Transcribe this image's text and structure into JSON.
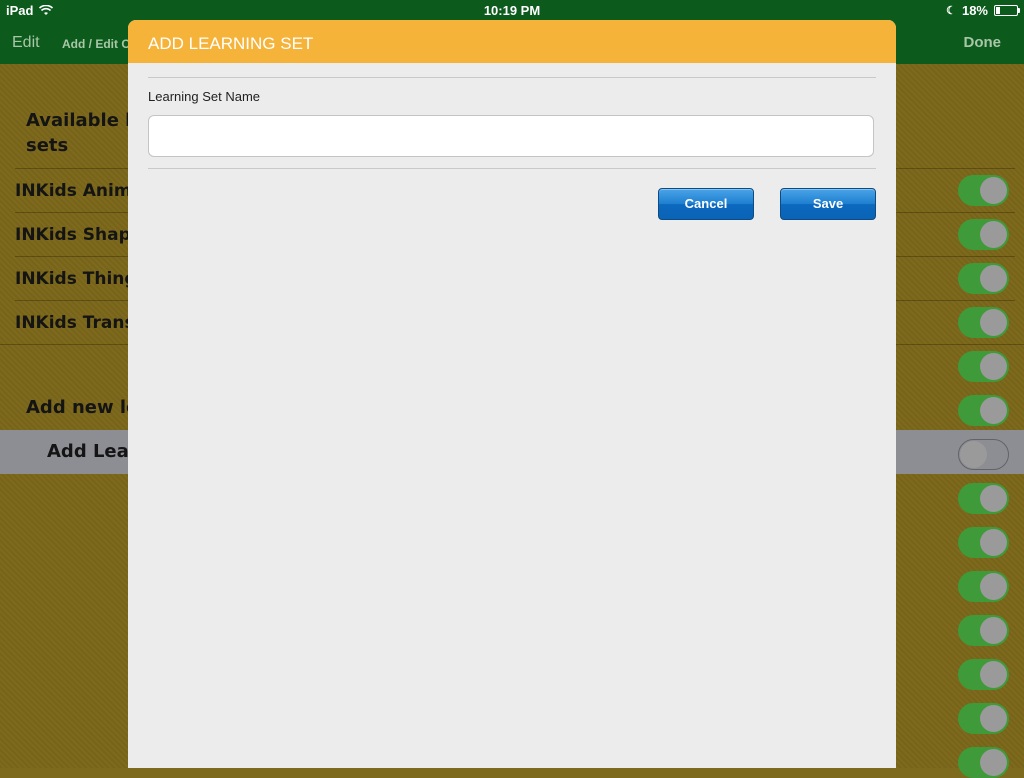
{
  "status_bar": {
    "device": "iPad",
    "time": "10:19 PM",
    "battery": "18%",
    "battery_level": 0.18,
    "icons": [
      "wifi-icon",
      "moon-icon",
      "battery-icon"
    ]
  },
  "nav": {
    "edit_label": "Edit",
    "title": "Add / Edit C",
    "done_label": "Done"
  },
  "background": {
    "available_header": "Available le\nsets",
    "available_header_line1": "Available le",
    "available_header_line2": "sets",
    "sets": [
      {
        "label": "INKids Anima"
      },
      {
        "label": "INKids Shape"
      },
      {
        "label": "INKids Thing"
      },
      {
        "label": "INKids Trans"
      }
    ],
    "add_new_header": "Add new le",
    "add_row_label": "Add Lear",
    "toggles": [
      true,
      true,
      true,
      true,
      true,
      true,
      false,
      true,
      true,
      true,
      true,
      true,
      true,
      true
    ]
  },
  "modal": {
    "title": "ADD LEARNING SET",
    "field_label": "Learning Set Name",
    "field_value": "",
    "field_placeholder": "",
    "cancel_label": "Cancel",
    "save_label": "Save"
  },
  "colors": {
    "nav_green": "#0d5a1d",
    "modal_header": "#f6b33a",
    "button_blue": "#1d7fd0",
    "toggle_on": "#3f9a3a"
  }
}
